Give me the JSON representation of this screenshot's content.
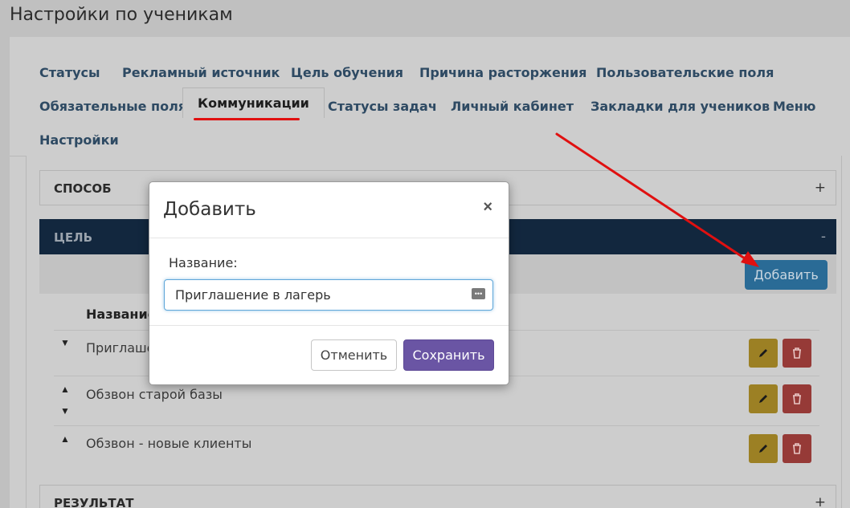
{
  "page": {
    "title": "Настройки по ученикам"
  },
  "tabs": [
    {
      "label": "Статусы"
    },
    {
      "label": "Рекламный источник"
    },
    {
      "label": "Цель обучения"
    },
    {
      "label": "Причина расторжения"
    },
    {
      "label": "Пользовательские поля"
    },
    {
      "label": "Обязательные поля"
    },
    {
      "label": "Коммуникации",
      "active": true
    },
    {
      "label": "Статусы задач"
    },
    {
      "label": "Личный кабинет"
    },
    {
      "label": "Закладки для учеников"
    },
    {
      "label": "Меню"
    },
    {
      "label": "Настройки"
    }
  ],
  "sections": {
    "method": {
      "label": "СПОСОБ",
      "toggle": "+"
    },
    "goal": {
      "label": "ЦЕЛЬ",
      "toggle": "-"
    },
    "result": {
      "label": "РЕЗУЛЬТАТ",
      "toggle": "+"
    }
  },
  "goal_table": {
    "add_label": "Добавить",
    "column_name": "Название",
    "rows": [
      {
        "name": "Приглаше"
      },
      {
        "name": "Обзвон старой базы"
      },
      {
        "name": "Обзвон - новые клиенты"
      }
    ]
  },
  "modal": {
    "title": "Добавить",
    "close": "×",
    "field_label": "Название:",
    "field_value": "Приглашение в лагерь",
    "cancel_label": "Отменить",
    "save_label": "Сохранить"
  },
  "colors": {
    "annotation_red": "#e01010",
    "save_button": "#6a55a4",
    "add_button": "#2a6b96",
    "section_active": "#12273e"
  },
  "icons": {
    "edit": "pencil-icon",
    "delete": "trash-icon",
    "move_up": "arrow-up-icon",
    "move_down": "arrow-down-icon",
    "password": "password-dots-icon"
  }
}
